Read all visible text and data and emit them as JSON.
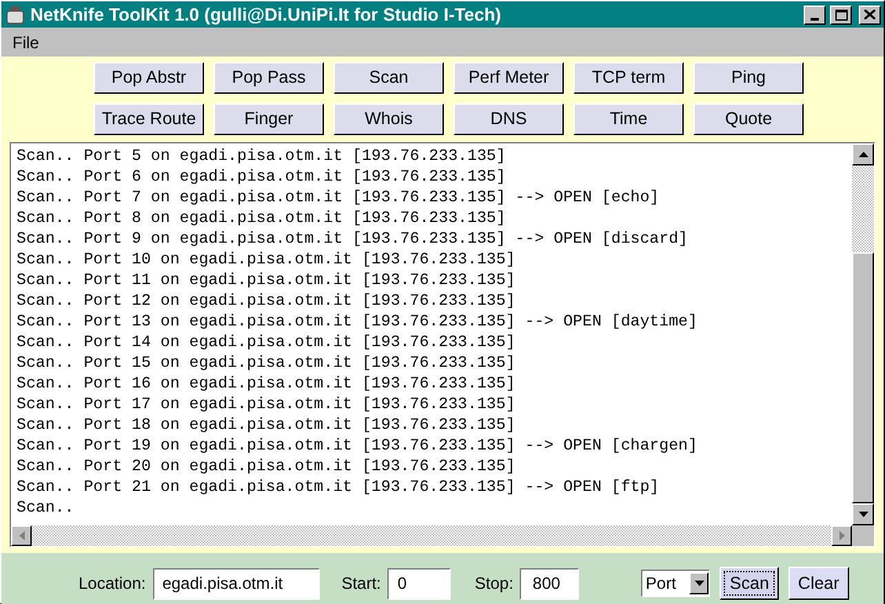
{
  "window": {
    "title": "NetKnife ToolKit 1.0 (gulli@Di.UniPi.It for Studio I-Tech)"
  },
  "menu": [
    "File"
  ],
  "tools": [
    "Pop Abstr",
    "Pop Pass",
    "Scan",
    "Perf Meter",
    "TCP term",
    "Ping",
    "Trace Route",
    "Finger",
    "Whois",
    "DNS",
    "Time",
    "Quote"
  ],
  "output": [
    "Scan.. Port 5 on egadi.pisa.otm.it [193.76.233.135]",
    "Scan.. Port 6 on egadi.pisa.otm.it [193.76.233.135]",
    "Scan.. Port 7 on egadi.pisa.otm.it [193.76.233.135] --> OPEN [echo]",
    "Scan.. Port 8 on egadi.pisa.otm.it [193.76.233.135]",
    "Scan.. Port 9 on egadi.pisa.otm.it [193.76.233.135] --> OPEN [discard]",
    "Scan.. Port 10 on egadi.pisa.otm.it [193.76.233.135]",
    "Scan.. Port 11 on egadi.pisa.otm.it [193.76.233.135]",
    "Scan.. Port 12 on egadi.pisa.otm.it [193.76.233.135]",
    "Scan.. Port 13 on egadi.pisa.otm.it [193.76.233.135] --> OPEN [daytime]",
    "Scan.. Port 14 on egadi.pisa.otm.it [193.76.233.135]",
    "Scan.. Port 15 on egadi.pisa.otm.it [193.76.233.135]",
    "Scan.. Port 16 on egadi.pisa.otm.it [193.76.233.135]",
    "Scan.. Port 17 on egadi.pisa.otm.it [193.76.233.135]",
    "Scan.. Port 18 on egadi.pisa.otm.it [193.76.233.135]",
    "Scan.. Port 19 on egadi.pisa.otm.it [193.76.233.135] --> OPEN [chargen]",
    "Scan.. Port 20 on egadi.pisa.otm.it [193.76.233.135]",
    "Scan.. Port 21 on egadi.pisa.otm.it [193.76.233.135] --> OPEN [ftp]",
    "Scan.."
  ],
  "controls": {
    "location_label": "Location:",
    "location": "egadi.pisa.otm.it",
    "start_label": "Start:",
    "start": "0",
    "stop_label": "Stop:",
    "stop": "800",
    "mode": "Port",
    "buttons": [
      {
        "label": "Scan",
        "focused": true
      },
      {
        "label": "Clear",
        "focused": false
      }
    ]
  }
}
